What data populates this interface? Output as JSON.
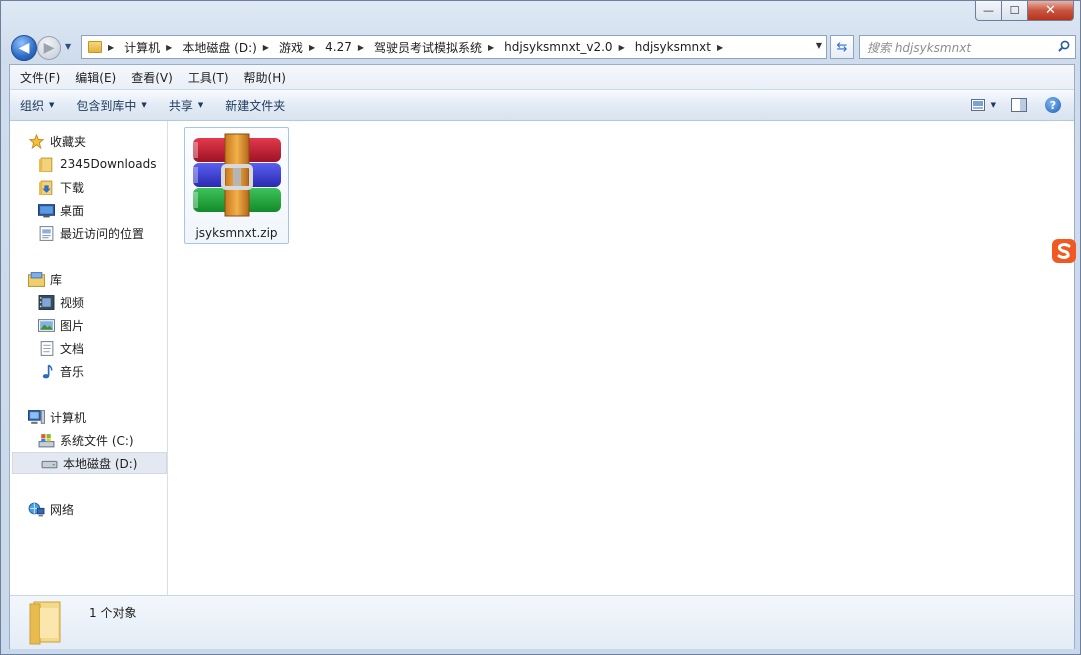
{
  "window": {
    "minimize_label": "—",
    "maximize_label": "☐",
    "close_label": "✕"
  },
  "address": {
    "breadcrumbs": [
      "计算机",
      "本地磁盘 (D:)",
      "游戏",
      "4.27",
      "驾驶员考试模拟系统",
      "hdjsyksmnxt_v2.0",
      "hdjsyksmnxt"
    ],
    "search_placeholder": "搜索 hdjsyksmnxt"
  },
  "menu": [
    "文件(F)",
    "编辑(E)",
    "查看(V)",
    "工具(T)",
    "帮助(H)"
  ],
  "toolbar": {
    "organize": "组织",
    "include_in_library": "包含到库中",
    "share": "共享",
    "new_folder": "新建文件夹",
    "help": "?"
  },
  "nav": {
    "favorites": {
      "label": "收藏夹",
      "items": [
        "2345Downloads",
        "下载",
        "桌面",
        "最近访问的位置"
      ]
    },
    "libraries": {
      "label": "库",
      "items": [
        "视频",
        "图片",
        "文档",
        "音乐"
      ]
    },
    "computer": {
      "label": "计算机",
      "items": [
        "系统文件 (C:)",
        "本地磁盘 (D:)"
      ]
    },
    "network": {
      "label": "网络"
    }
  },
  "files": [
    {
      "name": "jsyksmnxt.zip",
      "icon": "winrar-archive-icon"
    }
  ],
  "details": {
    "count": "1 个对象"
  },
  "colors": {
    "accent": "#2d6cc7",
    "selection": "#e4e9f1"
  }
}
